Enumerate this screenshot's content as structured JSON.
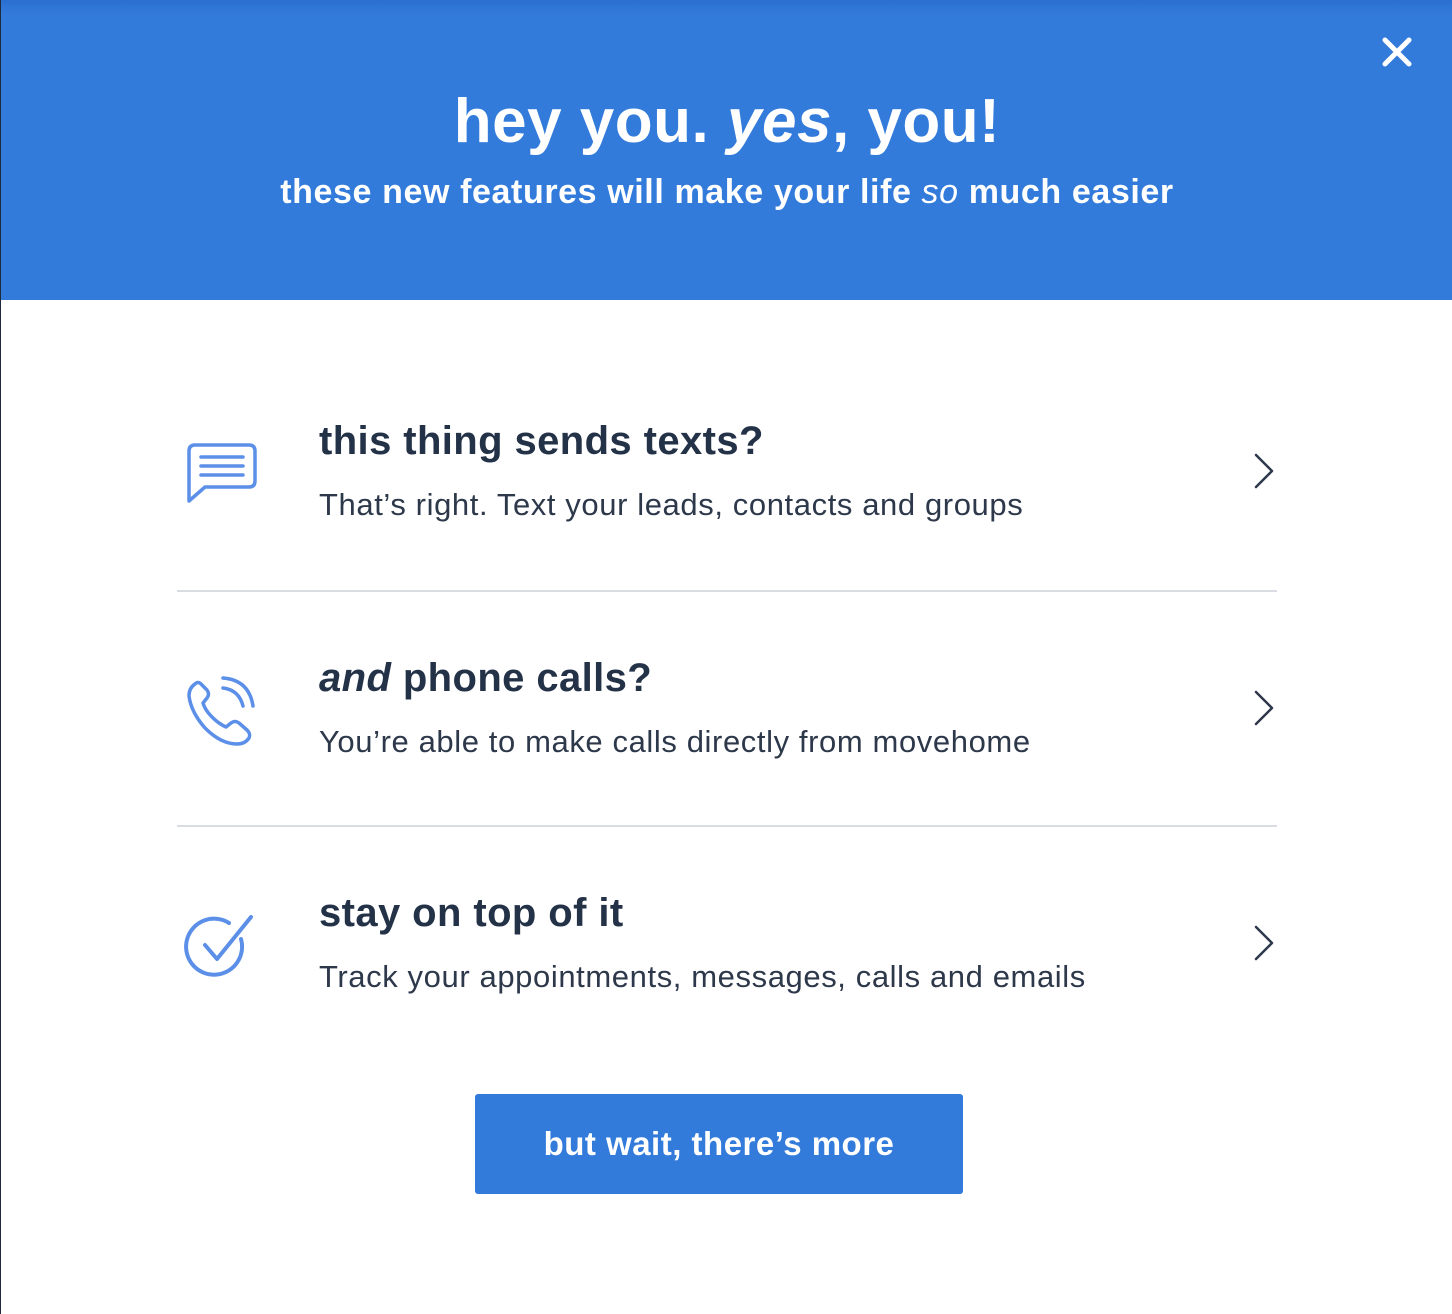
{
  "colors": {
    "brand_blue": "#327bdb",
    "icon_blue": "#5b8fe8",
    "title_text": "#243248",
    "body_text": "#2d394b",
    "divider": "#d9dde3"
  },
  "header": {
    "headline_part1": "hey you. ",
    "headline_emphasis": "yes",
    "headline_part2": ", you!",
    "subhead_part1": "these new features will make your life ",
    "subhead_emphasis": "so",
    "subhead_part2": " much easier",
    "close_icon": "close-icon"
  },
  "features": [
    {
      "icon": "message-icon",
      "title": "this thing sends texts?",
      "description": "That’s right. Text your leads, contacts and groups",
      "chevron_icon": "chevron-right-icon"
    },
    {
      "icon": "phone-call-icon",
      "title_emphasis": "and",
      "title_rest": " phone calls?",
      "description": "You’re able to make calls directly from movehome",
      "chevron_icon": "chevron-right-icon"
    },
    {
      "icon": "checkmark-icon",
      "title": "stay on top of it",
      "description": "Track your appointments, messages, calls and emails",
      "chevron_icon": "chevron-right-icon"
    }
  ],
  "cta": {
    "label": "but wait, there’s more"
  }
}
